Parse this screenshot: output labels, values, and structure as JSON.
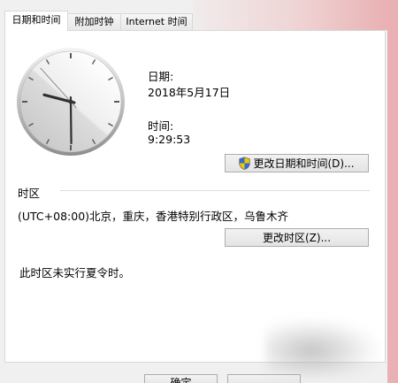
{
  "tabs": [
    {
      "label": "日期和时间",
      "selected": true
    },
    {
      "label": "附加时钟",
      "selected": false
    },
    {
      "label": "Internet 时间",
      "selected": false
    }
  ],
  "datetime": {
    "date_label": "日期:",
    "date_value": "2018年5月17日",
    "time_label": "时间:",
    "time_value": "9:29:53",
    "change_button_label": "更改日期和时间(D)..."
  },
  "timezone": {
    "section_label": "时区",
    "value": "(UTC+08:00)北京，重庆，香港特别行政区，乌鲁木齐",
    "change_button_label": "更改时区(Z)...",
    "dst_note": "此时区未实行夏令时。"
  },
  "footer": {
    "ok_button_label": "确定"
  },
  "icons": {
    "clock": "analog-clock-icon",
    "change_datetime_button": "uac-shield-icon"
  },
  "colors": {
    "frame_pink": "#e9b1b3",
    "dialog_bg": "#f0f0f0",
    "panel_bg": "#ffffff",
    "border": "#d9d9d9",
    "button_border": "#acacac"
  }
}
